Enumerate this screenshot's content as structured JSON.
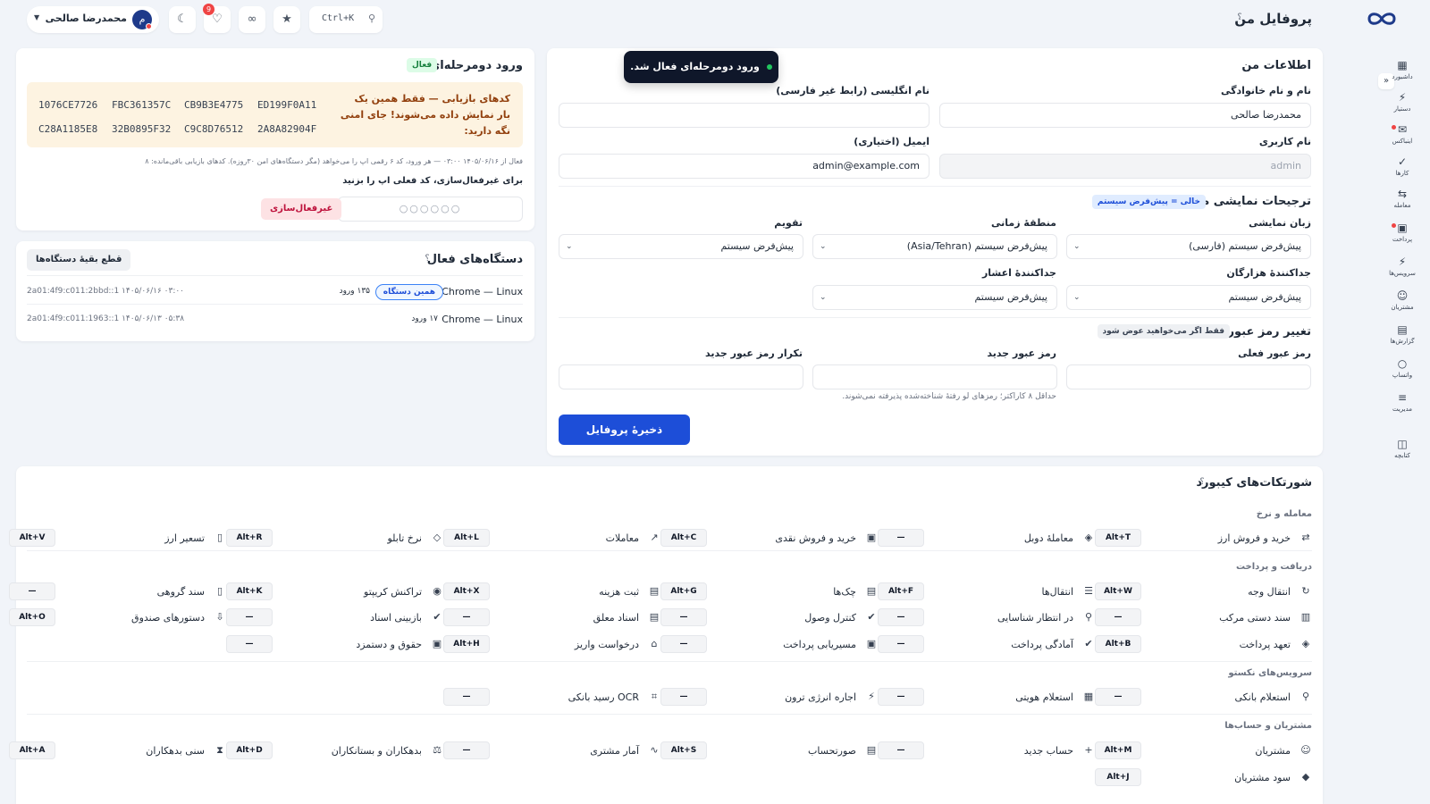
{
  "header": {
    "page_title": "پروفایل من",
    "help": "؟",
    "search_shortcut": "Ctrl+K",
    "notification_count": "9",
    "user_name": "محمدرضا صالحی",
    "user_initial": "م"
  },
  "sidebar": {
    "items": [
      {
        "label": "داشبورد",
        "icon": "grid-icon"
      },
      {
        "label": "دستیار",
        "icon": "bolt-icon"
      },
      {
        "label": "اینباکس",
        "icon": "inbox-icon"
      },
      {
        "label": "کارها",
        "icon": "check-icon"
      },
      {
        "label": "معامله",
        "icon": "exchange-icon"
      },
      {
        "label": "پرداخت",
        "icon": "payment-icon"
      },
      {
        "label": "سرویس‌ها",
        "icon": "bolt-icon"
      },
      {
        "label": "مشتریان",
        "icon": "users-icon"
      },
      {
        "label": "گزارش‌ها",
        "icon": "report-icon"
      },
      {
        "label": "واتساپ",
        "icon": "chat-icon"
      },
      {
        "label": "مدیریت",
        "icon": "sliders-icon"
      },
      {
        "label": "کتابچه",
        "icon": "book-icon"
      }
    ]
  },
  "toast": {
    "text": "ورود دومرحله‌ای فعال شد."
  },
  "profile": {
    "title": "اطلاعات من",
    "full_name_label": "نام و نام خانوادگی",
    "full_name_value": "محمدرضا صالحی",
    "english_name_label": "نام انگلیسی (رابط غیر فارسی)",
    "english_name_value": "",
    "username_label": "نام کاربری",
    "username_value": "admin",
    "email_label": "ایمیل (اختیاری)",
    "email_value": "admin@example.com",
    "prefs_title": "ترجیحات نمایشی من",
    "prefs_tag": "خالی = پیش‌فرض سیستم",
    "language_label": "زبان نمایشی",
    "language_value": "پیش‌فرض سیستم (فارسی)",
    "timezone_label": "منطقهٔ زمانی",
    "timezone_value": "پیش‌فرض سیستم (Asia/Tehran)",
    "calendar_label": "تقویم",
    "calendar_value": "پیش‌فرض سیستم",
    "thousands_label": "جداکنندهٔ هزارگان",
    "thousands_value": "پیش‌فرض سیستم",
    "decimal_label": "جداکنندهٔ اعشار",
    "decimal_value": "پیش‌فرض سیستم",
    "password_title": "تغییر رمز عبور",
    "password_tag": "فقط اگر می‌خواهید عوض شود",
    "current_pw_label": "رمز عبور فعلی",
    "new_pw_label": "رمز عبور جدید",
    "repeat_pw_label": "تکرار رمز عبور جدید",
    "pw_hint": "حداقل ۸ کاراکتر؛ رمزهای لو رفتهٔ شناخته‌شده پذیرفته نمی‌شوند.",
    "save_label": "ذخیرهٔ پروفایل"
  },
  "twofa": {
    "title": "ورود دومرحله‌ای",
    "status": "فعال",
    "warning": "کدهای بازیابی — فقط همین یک بار نمایش داده می‌شوند! جای امنی نگه دارید:",
    "codes": [
      "1076CE7726",
      "FBC361357C",
      "CB9B3E4775",
      "ED199F0A11",
      "C28A1185E8",
      "32B0895F32",
      "C9C8D76512",
      "2A8A82904F"
    ],
    "info": "فعال از ۱۴۰۵/۰۶/۱۶ ۰۳:۰۰ — هر ورود، کد ۶ رقمی اپ را می‌خواهد (مگر دستگاه‌های امن ۳۰روزه). کدهای بازیابی باقی‌مانده: ۸",
    "disable_prompt": "برای غیرفعال‌سازی، کد فعلی اپ را بزنید",
    "code_placeholder": "○○○○○○",
    "disable_button": "غیرفعال‌سازی"
  },
  "devices": {
    "title": "دستگاه‌های فعال",
    "help": "؟",
    "revoke_button": "قطع بقیهٔ دستگاه‌ها",
    "rows": [
      {
        "name": "Chrome — Linux",
        "badge": "همین دستگاه",
        "logins": "۱۳۵ ورود",
        "meta": "2a01:4f9:c011:2bbd::1   ۱۴۰۵/۰۶/۱۶ ۰۳:۰۰"
      },
      {
        "name": "Chrome — Linux",
        "badge": "",
        "logins": "۱۷ ورود",
        "meta": "2a01:4f9:c011:1963::1   ۱۴۰۵/۰۶/۱۳ ۰۵:۳۸"
      }
    ]
  },
  "shortcuts": {
    "title": "شورتکات‌های کیبورد",
    "help": "؟",
    "groups": [
      {
        "title": "معامله و نرخ",
        "rows": [
          [
            {
              "label": "خرید و فروش ارز",
              "key": "Alt+T",
              "icon": "exchange-icon"
            },
            {
              "label": "معاملهٔ دوبل",
              "key": "—",
              "icon": "layers-icon"
            },
            {
              "label": "خرید و فروش نقدی",
              "key": "Alt+C",
              "icon": "cash-icon"
            },
            {
              "label": "معاملات",
              "key": "Alt+L",
              "icon": "trend-icon"
            },
            {
              "label": "نرخ تابلو",
              "key": "Alt+R",
              "icon": "tag-icon"
            },
            {
              "label": "تسعیر ارز",
              "key": "Alt+V",
              "icon": "clipboard-icon"
            }
          ]
        ]
      },
      {
        "title": "دریافت و پرداخت",
        "rows": [
          [
            {
              "label": "انتقال وجه",
              "key": "Alt+W",
              "icon": "transfer-icon"
            },
            {
              "label": "انتقال‌ها",
              "key": "Alt+F",
              "icon": "list-icon"
            },
            {
              "label": "چک‌ها",
              "key": "Alt+G",
              "icon": "document-icon"
            },
            {
              "label": "ثبت هزینه",
              "key": "Alt+X",
              "icon": "document-icon"
            },
            {
              "label": "تراکنش کریپتو",
              "key": "Alt+K",
              "icon": "coin-icon"
            },
            {
              "label": "سند گروهی",
              "key": "—",
              "icon": "clipboard-icon"
            }
          ],
          [
            {
              "label": "سند دستی مرکب",
              "key": "—",
              "icon": "book-icon"
            },
            {
              "label": "در انتظار شناسایی",
              "key": "—",
              "icon": "search-icon"
            },
            {
              "label": "کنترل وصول",
              "key": "—",
              "icon": "check-circle-icon"
            },
            {
              "label": "اسناد معلق",
              "key": "—",
              "icon": "document-icon"
            },
            {
              "label": "بازبینی اسناد",
              "key": "—",
              "icon": "check-circle-icon"
            },
            {
              "label": "دستورهای صندوق",
              "key": "Alt+O",
              "icon": "inbox-icon"
            }
          ],
          [
            {
              "label": "تعهد پرداخت",
              "key": "Alt+B",
              "icon": "layers-icon"
            },
            {
              "label": "آمادگی پرداخت",
              "key": "—",
              "icon": "check-circle-icon"
            },
            {
              "label": "مسیریابی پرداخت",
              "key": "—",
              "icon": "cash-icon"
            },
            {
              "label": "درخواست واریز",
              "key": "Alt+H",
              "icon": "bank-icon"
            },
            {
              "label": "حقوق و دستمزد",
              "key": "—",
              "icon": "cash-icon"
            }
          ]
        ]
      },
      {
        "title": "سرویس‌های نکستو",
        "rows": [
          [
            {
              "label": "استعلام بانکی",
              "key": "—",
              "icon": "search-icon"
            },
            {
              "label": "استعلام هویتی",
              "key": "—",
              "icon": "id-card-icon"
            },
            {
              "label": "اجاره انرژی ترون",
              "key": "—",
              "icon": "bolt-icon"
            },
            {
              "label": "OCR رسید بانکی",
              "key": "—",
              "icon": "scan-icon"
            }
          ]
        ]
      },
      {
        "title": "مشتریان و حساب‌ها",
        "rows": [
          [
            {
              "label": "مشتریان",
              "key": "Alt+M",
              "icon": "users-icon"
            },
            {
              "label": "حساب جدید",
              "key": "—",
              "icon": "plus-icon"
            },
            {
              "label": "صورتحساب",
              "key": "Alt+S",
              "icon": "document-icon"
            },
            {
              "label": "آمار مشتری",
              "key": "—",
              "icon": "pulse-icon"
            },
            {
              "label": "بدهکاران و بستانکاران",
              "key": "Alt+D",
              "icon": "scale-icon"
            },
            {
              "label": "سنی بدهکاران",
              "key": "Alt+A",
              "icon": "hourglass-icon"
            }
          ],
          [
            {
              "label": "سود مشتریان",
              "key": "Alt+J",
              "icon": "diamond-icon"
            }
          ]
        ]
      }
    ]
  }
}
